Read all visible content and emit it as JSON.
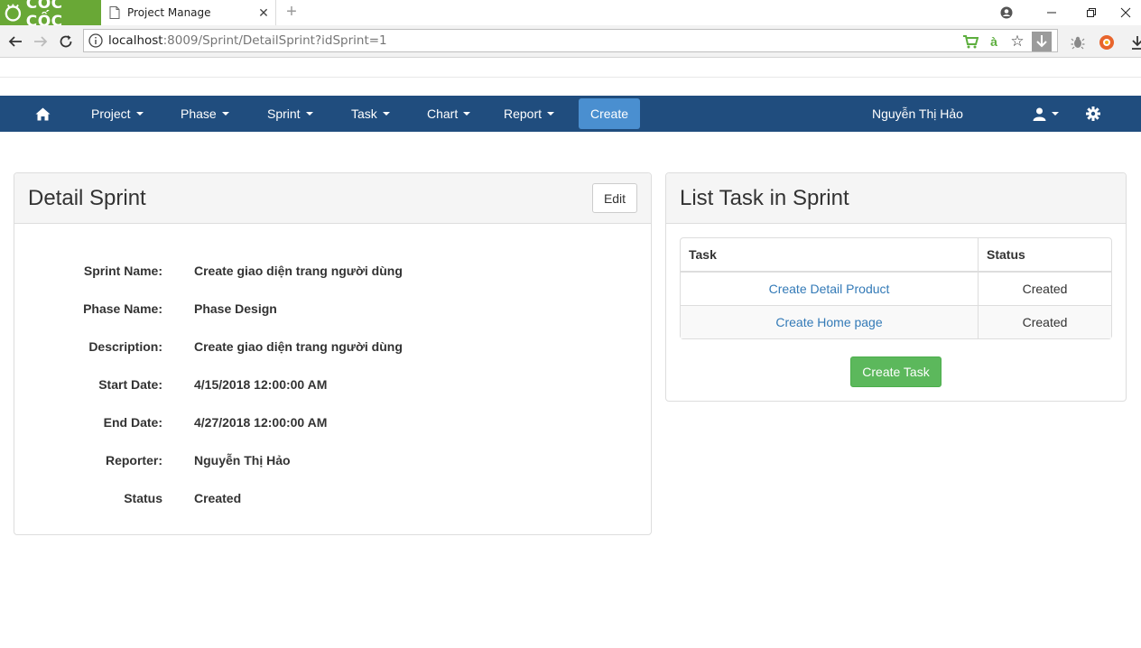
{
  "browser": {
    "brand_name": "CỐC CỐC",
    "tab_title": "Project Manage",
    "url_host": "localhost",
    "url_path": ":8009/Sprint/DetailSprint?idSprint=1",
    "brand_color": "#69a836"
  },
  "nav": {
    "items": [
      {
        "label": "Project"
      },
      {
        "label": "Phase"
      },
      {
        "label": "Sprint"
      },
      {
        "label": "Task"
      },
      {
        "label": "Chart"
      },
      {
        "label": "Report"
      }
    ],
    "create_label": "Create",
    "user_name": "Nguyễn Thị Hảo",
    "bar_color": "#204d7e",
    "create_color": "#4a8fd0"
  },
  "detail": {
    "title": "Detail Sprint",
    "edit_label": "Edit",
    "fields": [
      {
        "label": "Sprint Name:",
        "value": "Create giao diện trang người dùng"
      },
      {
        "label": "Phase Name:",
        "value": "Phase Design"
      },
      {
        "label": "Description:",
        "value": "Create giao diện trang người dùng"
      },
      {
        "label": "Start Date:",
        "value": "4/15/2018 12:00:00 AM"
      },
      {
        "label": "End Date:",
        "value": "4/27/2018 12:00:00 AM"
      },
      {
        "label": "Reporter:",
        "value": "Nguyễn Thị Hảo"
      },
      {
        "label": "Status",
        "value": "Created"
      }
    ]
  },
  "tasks": {
    "title": "List Task in Sprint",
    "columns": [
      "Task",
      "Status"
    ],
    "rows": [
      {
        "task": "Create Detail Product",
        "status": "Created"
      },
      {
        "task": "Create Home page",
        "status": "Created"
      }
    ],
    "create_label": "Create Task",
    "create_color": "#5cb85c"
  }
}
